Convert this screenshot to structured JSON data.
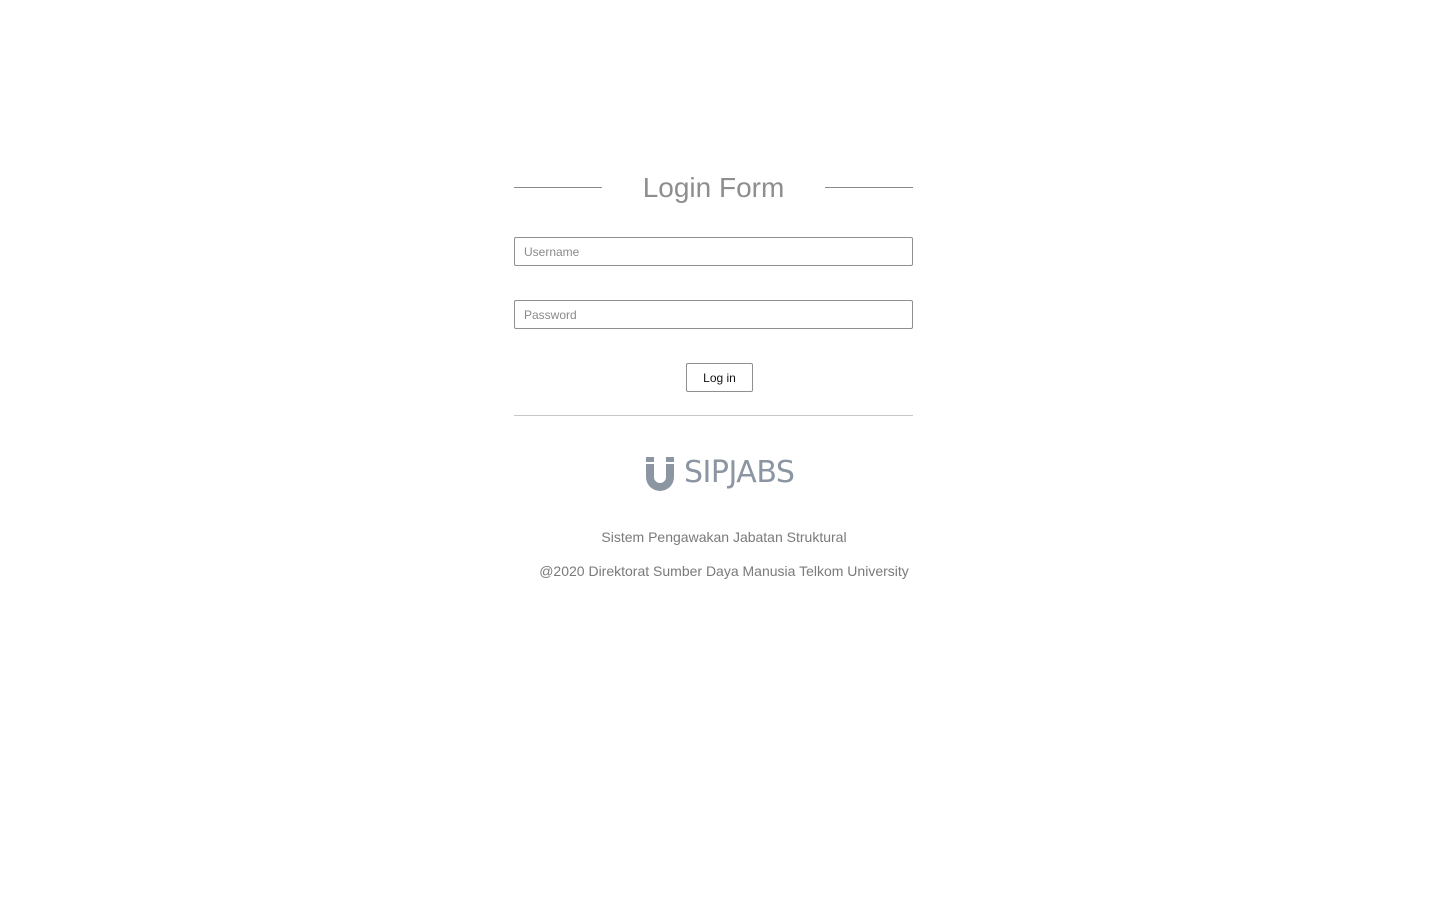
{
  "form": {
    "title": "Login Form",
    "username": {
      "placeholder": "Username",
      "value": ""
    },
    "password": {
      "placeholder": "Password",
      "value": ""
    },
    "submit_label": "Log in"
  },
  "brand": {
    "logo_text": "SIPJABS",
    "logo_icon": "telkom-u-logo-icon",
    "logo_color": "#8b96a2"
  },
  "footer": {
    "system_name": "Sistem Pengawakan Jabatan Struktural",
    "copyright": "@2020 Direktorat Sumber Daya Manusia Telkom University"
  }
}
